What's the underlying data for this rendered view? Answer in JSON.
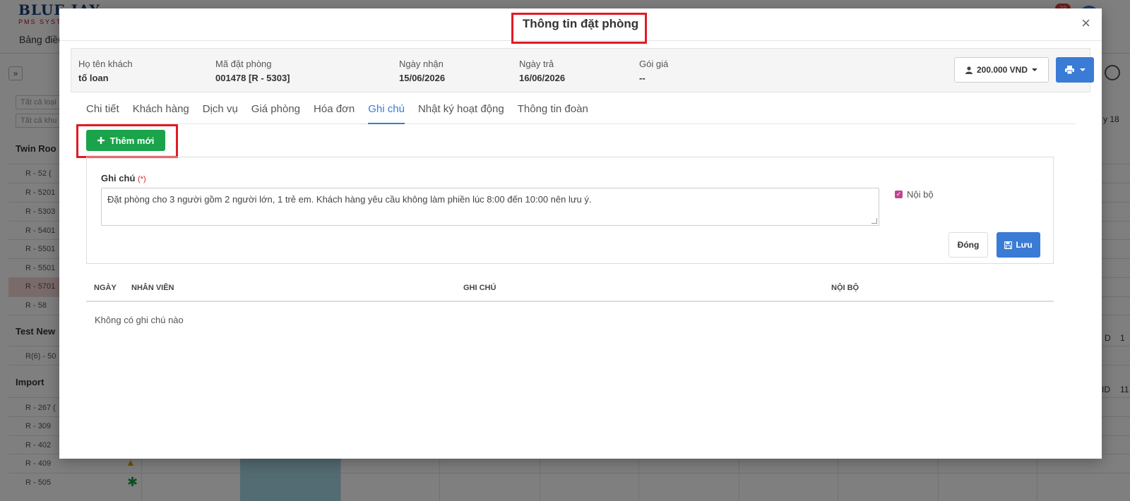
{
  "background": {
    "logo": "BLUE JAY",
    "logo_sub": "PMS SYSTEM",
    "menu_item": "Bảng điều",
    "notification_count": "23",
    "filter_type": "Tất cả loại",
    "filter_area": "Tất cả khu",
    "groups": [
      {
        "label": "Twin Roo",
        "rooms": [
          "R - 52 (",
          "R - 5201",
          "R - 5303",
          "R - 5401",
          "R - 5501",
          "R - 5501",
          "R - 5701",
          "R - 58"
        ]
      },
      {
        "label": "Test New",
        "rooms": [
          "R(6) - 50"
        ]
      },
      {
        "label": "Import",
        "rooms": [
          "R - 267 (",
          "R - 309",
          "R - 402",
          "R - 409",
          "R - 505"
        ]
      }
    ],
    "right_texts": [
      "y 18",
      "D",
      "1",
      "ID",
      "11"
    ]
  },
  "modal": {
    "title": "Thông tin đặt phòng",
    "close": "×",
    "info": {
      "guest_label": "Họ tên khách",
      "guest_value": "tố loan",
      "booking_code_label": "Mã đặt phòng",
      "booking_code_value": "001478 [R - 5303]",
      "checkin_label": "Ngày nhận",
      "checkin_value": "15/06/2026",
      "checkout_label": "Ngày trả",
      "checkout_value": "16/06/2026",
      "rate_label": "Gói giá",
      "rate_value": "--"
    },
    "price_button": "200.000 VND",
    "tabs": [
      {
        "label": "Chi tiết"
      },
      {
        "label": "Khách hàng"
      },
      {
        "label": "Dịch vụ"
      },
      {
        "label": "Giá phòng"
      },
      {
        "label": "Hóa đơn"
      },
      {
        "label": "Ghi chú",
        "active": true
      },
      {
        "label": "Nhật ký hoạt động"
      },
      {
        "label": "Thông tin đoàn"
      }
    ],
    "add_button": "Thêm mới",
    "form": {
      "label": "Ghi chú",
      "required_mark": "(*)",
      "note_value": "Đặt phòng cho 3 người gồm 2 người lớn, 1 trẻ em. Khách hàng yêu cầu không làm phiền lúc 8:00 đến 10:00 nên lưu ý.",
      "internal_label": "Nội bộ",
      "internal_checked": true,
      "close_button": "Đóng",
      "save_button": "Lưu"
    },
    "table": {
      "headers": [
        "NGÀY",
        "NHÂN VIÊN",
        "GHI CHÚ",
        "NỘI BỘ"
      ],
      "empty": "Không có ghi chú nào"
    }
  },
  "colors": {
    "accent": "#3a7bd5",
    "success": "#1aa34a",
    "highlight": "#e01b24"
  }
}
